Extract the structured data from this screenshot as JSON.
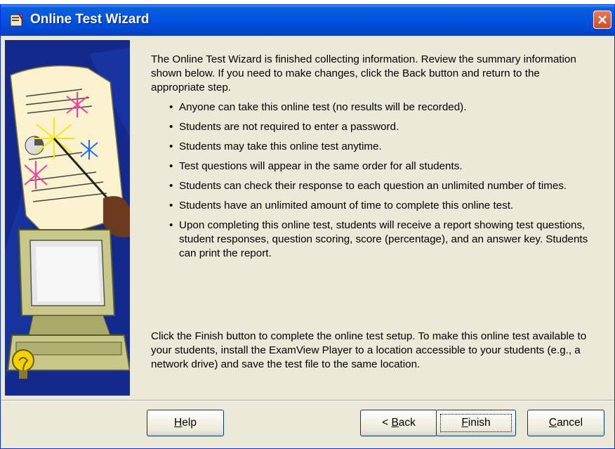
{
  "window": {
    "title": "Online Test Wizard"
  },
  "intro": "The Online Test Wizard is finished collecting information.  Review the summary information shown below.  If you need to make changes, click the Back button and return to the appropriate step.",
  "summary": [
    "Anyone can take this online test (no results will be recorded).",
    "Students are not required to enter a password.",
    "Students may take this online test anytime.",
    "Test questions will appear in the same order for all students.",
    "Students can check their response to each question an unlimited number of times.",
    "Students have an unlimited amount of time to complete this online test.",
    "Upon completing this online test, students will receive a report showing test questions, student responses, question scoring, score (percentage), and an answer key.  Students can print the report."
  ],
  "bullet_char": "•",
  "closing": "Click the Finish button to complete the online test setup.  To make this online test available to your students, install the ExamView Player to a location accessible to your students (e.g., a network drive) and save the test file to the same location.",
  "buttons": {
    "help": {
      "mnemonic": "H",
      "rest": "elp"
    },
    "back": {
      "prefix": "< ",
      "mnemonic": "B",
      "rest": "ack"
    },
    "finish": {
      "mnemonic": "F",
      "rest": "inish"
    },
    "cancel": {
      "mnemonic": "C",
      "rest": "ancel"
    }
  },
  "colors": {
    "titlebar": "#0055e5",
    "dialog_bg": "#ece9d8",
    "art_bg": "#132a8c",
    "close_button": "#d64a24"
  }
}
